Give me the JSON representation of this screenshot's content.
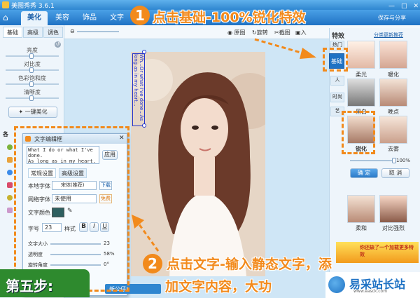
{
  "titlebar": {
    "title": "美图秀秀 3.6.1"
  },
  "tabs": [
    {
      "label": "美化"
    },
    {
      "label": "美容"
    },
    {
      "label": "饰品"
    },
    {
      "label": "文字"
    }
  ],
  "header_right": {
    "save": "保存与分享"
  },
  "toolbar": {
    "original": "原图",
    "rotate": "旋转",
    "crop": "截图",
    "more": "入"
  },
  "left_panel": {
    "subtabs": [
      "基础",
      "高级",
      "调色"
    ],
    "sliders": [
      {
        "label": "亮度"
      },
      {
        "label": "对比度"
      },
      {
        "label": "色彩饱和度"
      },
      {
        "label": "清晰度"
      }
    ],
    "one_click": "一键美化",
    "section_label": "各"
  },
  "text_overlay": "Wh...Or what I've done...As long as in my heart...",
  "right_panel": {
    "title": "特效",
    "link": "分类更新推荐",
    "categories": [
      "热门",
      "基础",
      "人",
      "时尚",
      "艺"
    ],
    "thumbs": [
      {
        "label": "柔光"
      },
      {
        "label": "暖化"
      },
      {
        "label": "黑白"
      },
      {
        "label": "晚点"
      },
      {
        "label": "锐化"
      },
      {
        "label": "去雾"
      },
      {
        "label": "柔和"
      },
      {
        "label": "对比强烈"
      }
    ],
    "percent": "100%",
    "confirm": "确 定",
    "cancel": "取 消",
    "ad": "你还缺了一个加载更多特效"
  },
  "dialog": {
    "title": "文字编辑框",
    "text": "What I do or what I've done.\nAs long as in my heart.",
    "apply": "应用",
    "tab1": "常规设置",
    "tab2": "高级设置",
    "font_label": "本地字体",
    "font_value": "宋体(推荐)",
    "download": "下载",
    "webfont_label": "网络字体",
    "webfont_value": "未使用",
    "free": "免费",
    "color_label": "文字颜色",
    "size_label": "字号",
    "size_value": "23",
    "style_label": "样式",
    "b": "B",
    "i": "I",
    "u": "U",
    "textsize_label": "文字大小",
    "textsize_value": "23",
    "opacity_label": "透明度",
    "opacity_value": "58%",
    "rotation_label": "旋转角度",
    "rotation_value": "0°",
    "status": "新公仔!"
  },
  "annotations": {
    "step1_num": "1",
    "step1_text": "点击基础-100%锐化特效",
    "step2_num": "2",
    "step2_line1": "点击文字-输入静态文字，添",
    "step2_line2": "加文字内容，大功",
    "step5": "第五步:",
    "watermark": "易采站长站",
    "watermark_sub": "www.easck.com"
  },
  "colors": {
    "accent": "#f28a1c",
    "brand": "#2f86d0",
    "text_box": "#2233cc",
    "swatch": "#2e5f5f"
  }
}
